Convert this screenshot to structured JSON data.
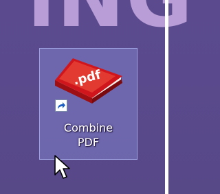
{
  "desktop": {
    "background_text": "iNG",
    "icon": {
      "label_line1": "Combine",
      "label_line2": "PDF",
      "badge_text": ".pdf",
      "icon_name": "pdf-book-icon",
      "shortcut_overlay": "shortcut-arrow-icon",
      "selected": true
    },
    "cursor": "arrow-pointer"
  },
  "colors": {
    "background": "#5a4a8d",
    "selection_fill": "#878cd7",
    "pdf_red": "#c4161c",
    "label_text": "#ffffff"
  }
}
